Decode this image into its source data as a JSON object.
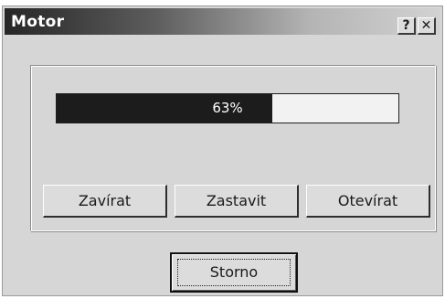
{
  "window": {
    "title": "Motor",
    "help_label": "?",
    "close_label": "✕"
  },
  "progress": {
    "value": 0.63,
    "label": "63%"
  },
  "buttons": {
    "close_gate": "Zavírat",
    "stop": "Zastavit",
    "open_gate": "Otevírat",
    "cancel": "Storno"
  },
  "colors": {
    "title_gradient_start": "#262626",
    "title_gradient_end": "#d2d2d2",
    "window_face": "#d6d6d6",
    "progress_fill": "#1c1c1c",
    "progress_track": "#f2f2f2"
  }
}
